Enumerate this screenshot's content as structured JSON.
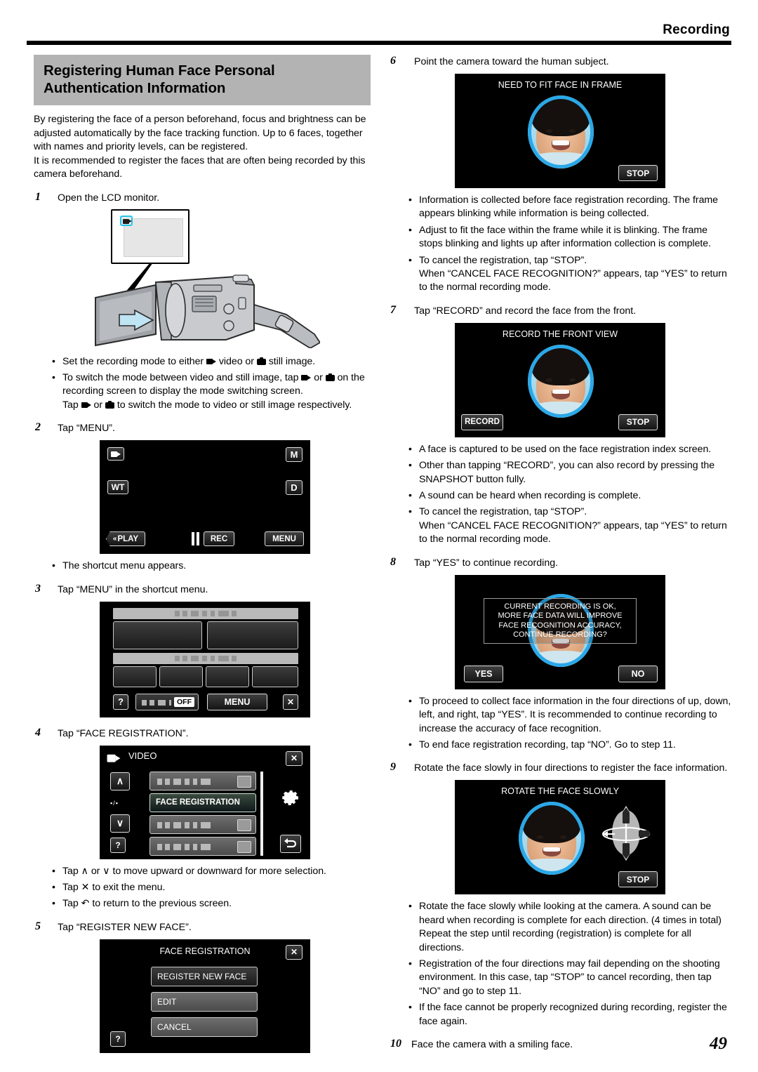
{
  "header": {
    "section": "Recording",
    "page_number": "49"
  },
  "title": {
    "line1": "Registering Human Face Personal",
    "line2": "Authentication Information"
  },
  "intro": {
    "p1": "By registering the face of a person beforehand, focus and brightness can be adjusted automatically by the face tracking function. Up to 6 faces, together with names and priority levels, can be registered.",
    "p2": "It is recommended to register the faces that are often being recorded by this camera beforehand."
  },
  "steps": {
    "s1": {
      "num": "1",
      "text": "Open the LCD monitor."
    },
    "s2": {
      "num": "2",
      "text": "Tap “MENU”."
    },
    "s3": {
      "num": "3",
      "text": "Tap “MENU” in the shortcut menu."
    },
    "s4": {
      "num": "4",
      "text": "Tap “FACE REGISTRATION”."
    },
    "s5": {
      "num": "5",
      "text": "Tap “REGISTER NEW FACE”."
    },
    "s6": {
      "num": "6",
      "text": "Point the camera toward the human subject."
    },
    "s7": {
      "num": "7",
      "text": "Tap “RECORD” and record the face from the front."
    },
    "s8": {
      "num": "8",
      "text": "Tap “YES” to continue recording."
    },
    "s9": {
      "num": "9",
      "text": "Rotate the face slowly in four directions to register the face information."
    },
    "s10": {
      "num": "10",
      "text": "Face the camera with a smiling face."
    }
  },
  "bullets_after_1": {
    "b1_pre": "Set the recording mode to either ",
    "b1_mid": " video or ",
    "b1_post": " still image.",
    "b2_pre": "To switch the mode between video and still image, tap ",
    "b2_mid": " or ",
    "b2_post": " on the recording screen to display the mode switching screen.",
    "b2_line2_pre": "Tap ",
    "b2_line2_mid": " or ",
    "b2_line2_post": " to switch the mode to video or still image respectively."
  },
  "bullets_after_2": {
    "b1": "The shortcut menu appears."
  },
  "bullets_after_4": {
    "b1": "Tap ∧ or ∨ to move upward or downward for more selection.",
    "b2": "Tap ✕ to exit the menu.",
    "b3": "Tap ↶ to return to the previous screen."
  },
  "bullets_after_6": {
    "b1": "Information is collected before face registration recording. The frame appears blinking while information is being collected.",
    "b2": "Adjust to fit the face within the frame while it is blinking. The frame stops blinking and lights up after information collection is complete.",
    "b3_l1": "To cancel the registration, tap “STOP”.",
    "b3_l2": "When “CANCEL FACE RECOGNITION?” appears, tap “YES” to return to the normal recording mode."
  },
  "bullets_after_7": {
    "b1": "A face is captured to be used on the face registration index screen.",
    "b2": "Other than tapping “RECORD”, you can also record by pressing the SNAPSHOT button fully.",
    "b3": "A sound can be heard when recording is complete.",
    "b4_l1": "To cancel the registration, tap “STOP”.",
    "b4_l2": "When “CANCEL FACE RECOGNITION?” appears, tap “YES” to return to the normal recording mode."
  },
  "bullets_after_8": {
    "b1": "To proceed to collect face information in the four directions of up, down, left, and right, tap “YES”. It is recommended to continue recording to increase the accuracy of face recognition.",
    "b2": "To end face registration recording, tap “NO”. Go to step 11."
  },
  "bullets_after_9": {
    "b1": "Rotate the face slowly while looking at the camera. A sound can be heard when recording is complete for each direction. (4 times in total) Repeat the step until recording (registration) is complete for all directions.",
    "b2": "Registration of the four directions may fail depending on the shooting environment. In this case, tap “STOP” to cancel recording, then tap “NO” and go to step 11.",
    "b3": "If the face cannot be properly recognized during recording, register the face again."
  },
  "screens": {
    "rec_standby": {
      "video_mode_icon": "video-camera-icon",
      "wt_label": "WT",
      "m_label": "M",
      "d_label": "D",
      "play_label": "PLAY",
      "rec_label": "REC",
      "menu_label": "MENU",
      "pause_icon": "pause-icon"
    },
    "shortcut_menu": {
      "off_label": "OFF",
      "menu_label": "MENU",
      "help_label": "?",
      "close_label": "✕"
    },
    "video_menu": {
      "title": "VIDEO",
      "title_icon": "video-camera-icon",
      "selected_item": "FACE REGISTRATION",
      "up_label": "∧",
      "down_label": "∨",
      "help_label": "?",
      "close_label": "✕",
      "gear_icon": "gear-icon",
      "back_icon": "back-arrow-icon",
      "page_indicator": "▪/▪"
    },
    "face_registration": {
      "title": "FACE REGISTRATION",
      "item1": "REGISTER NEW FACE",
      "item2": "EDIT",
      "item3": "CANCEL",
      "help_label": "?",
      "close_label": "✕"
    },
    "need_fit": {
      "message": "NEED TO FIT FACE IN FRAME",
      "stop_label": "STOP"
    },
    "record_front": {
      "message": "RECORD THE FRONT VIEW",
      "record_label": "RECORD",
      "stop_label": "STOP"
    },
    "continue_dialog": {
      "l1": "CURRENT RECORDING IS OK,",
      "l2": "MORE FACE DATA WILL IMPROVE",
      "l3": "FACE RECOGNITION ACCURACY,",
      "l4": "CONTINUE RECORDING?",
      "yes_label": "YES",
      "no_label": "NO"
    },
    "rotate_face": {
      "message": "ROTATE THE FACE SLOWLY",
      "stop_label": "STOP",
      "rotate_icon": "rotate-directions-icon"
    }
  },
  "colors": {
    "accent_blue": "#2aa8e8",
    "band_gray": "#b3b3b3",
    "cyan_highlight": "#22c6e8"
  }
}
